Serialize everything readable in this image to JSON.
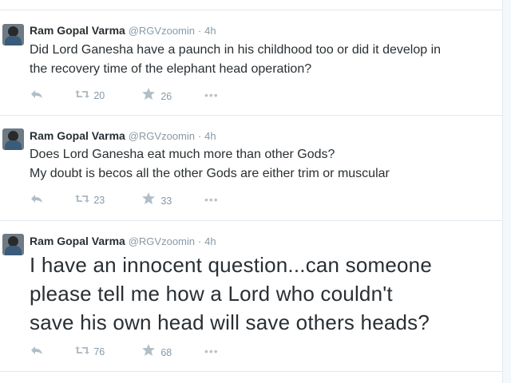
{
  "tweets": [
    {
      "name": "Ram Gopal Varma",
      "handle": "@RGVzoomin",
      "time": "4h",
      "lines": [
        "Did Lord Ganesha have a paunch in his childhood too or did it develop in",
        "the recovery time of the elephant head operation?"
      ],
      "retweets": "20",
      "favorites": "26"
    },
    {
      "name": "Ram Gopal Varma",
      "handle": "@RGVzoomin",
      "time": "4h",
      "lines": [
        "Does Lord Ganesha eat much more than other Gods?",
        "My doubt is becos all the other Gods are either trim or muscular"
      ],
      "retweets": "23",
      "favorites": "33"
    },
    {
      "name": "Ram Gopal Varma",
      "handle": "@RGVzoomin",
      "time": "4h",
      "lines": [
        "I have an innocent question...can someone",
        "please tell me how a Lord who couldn't",
        "save his own head will save others heads?"
      ],
      "retweets": "76",
      "favorites": "68"
    }
  ],
  "icons": {
    "reply": "reply-icon",
    "retweet": "retweet-icon",
    "favorite": "favorite-star-icon",
    "more": "more-options-icon"
  },
  "separator": "·"
}
